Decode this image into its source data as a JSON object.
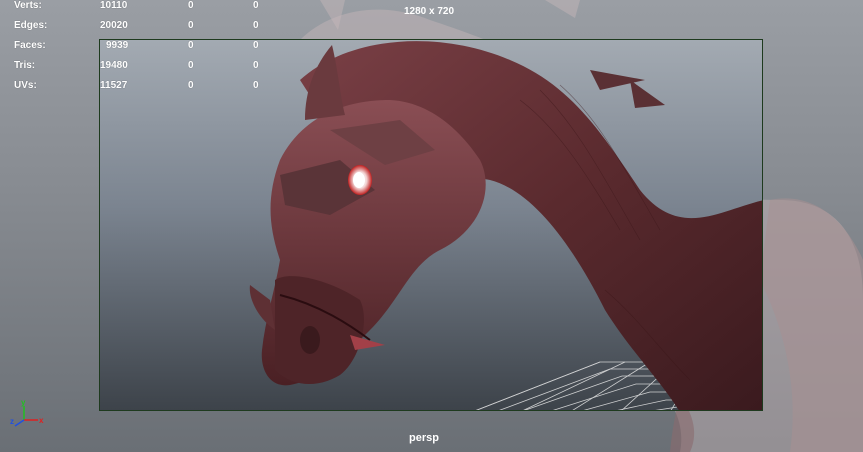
{
  "hud": {
    "stats": [
      {
        "label": "Verts:",
        "v1": "10110",
        "v2": "0",
        "v3": "0"
      },
      {
        "label": "Edges:",
        "v1": "20020",
        "v2": "0",
        "v3": "0"
      },
      {
        "label": "Faces:",
        "v1": "9939",
        "v2": "0",
        "v3": "0"
      },
      {
        "label": "Tris:",
        "v1": "19480",
        "v2": "0",
        "v3": "0"
      },
      {
        "label": "UVs:",
        "v1": "11527",
        "v2": "0",
        "v3": "0"
      }
    ],
    "resolution": "1280 x 720",
    "camera": "persp"
  },
  "axis_gizmo": {
    "x_label": "x",
    "y_label": "y",
    "z_label": "z"
  },
  "colors": {
    "x_axis": "#e02020",
    "y_axis": "#20c020",
    "z_axis": "#2050e0",
    "gate_border": "#1e3a1e",
    "grid": "#e8e8e8",
    "model_base": "#5a2a2e"
  }
}
